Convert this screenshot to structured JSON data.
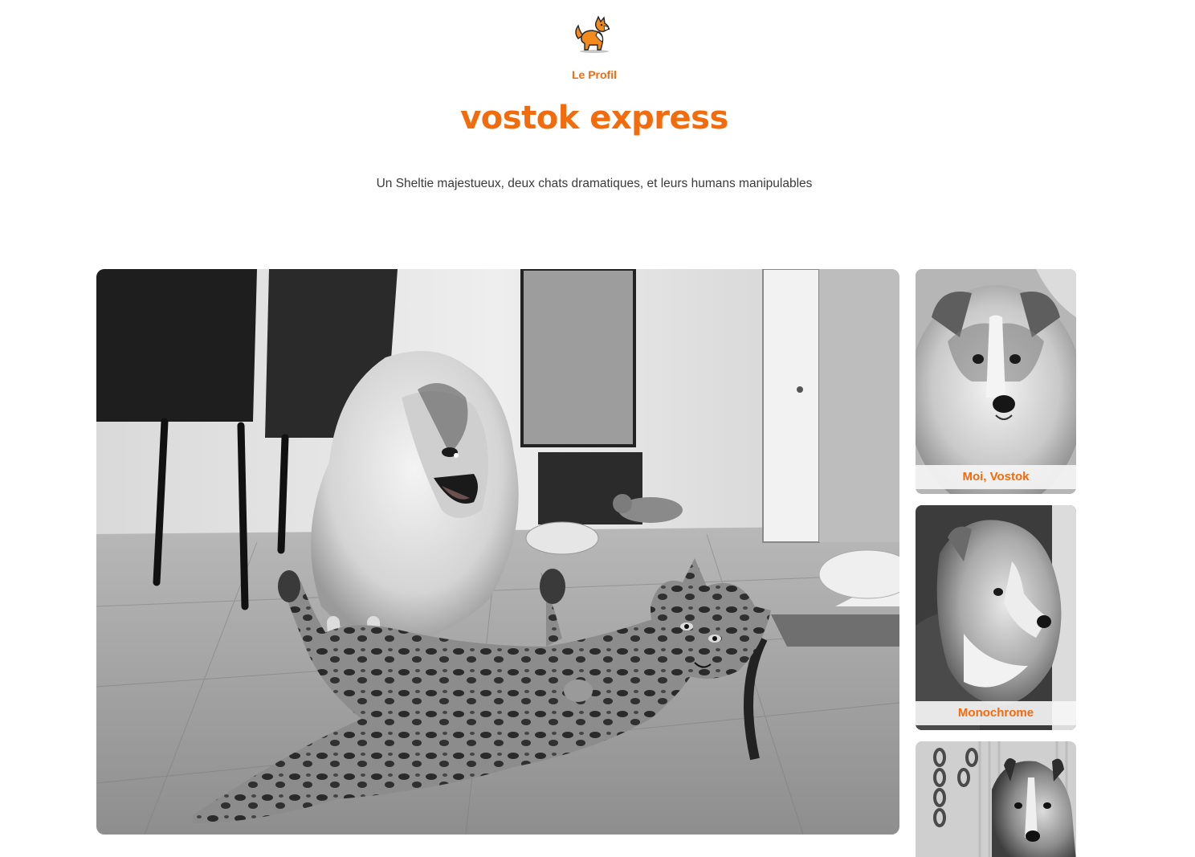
{
  "header": {
    "logo_icon": "sheltie-dog-logo-icon",
    "nav_link": "Le Profil",
    "site_title": "vostok express",
    "tagline": "Un Sheltie majestueux, deux chats dramatiques, et leurs humans manipulables"
  },
  "gallery": {
    "hero": {
      "image": "sheltie-and-bengal-cat-playing-photo"
    },
    "thumbnails": [
      {
        "image": "sheltie-puppy-portrait-photo",
        "caption": "Moi, Vostok"
      },
      {
        "image": "sheltie-profile-portrait-photo",
        "caption": "Monochrome"
      },
      {
        "image": "sheltie-on-swing-photo",
        "caption": ""
      }
    ]
  },
  "colors": {
    "accent": "#f26b0c",
    "text": "#3a3a3a",
    "background": "#ffffff"
  }
}
